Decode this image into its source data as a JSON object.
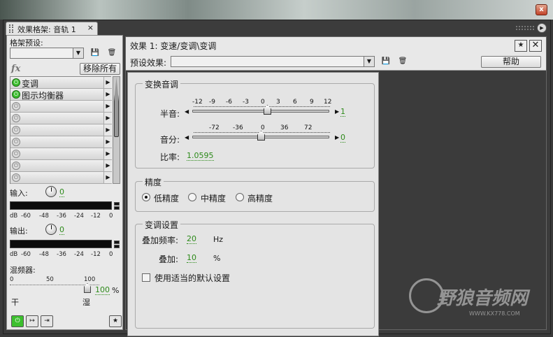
{
  "window": {
    "close_glyph": "x"
  },
  "panel_tab": {
    "title": "效果格架: 音轨 1",
    "close_glyph": "×",
    "menu_glyph": "▶"
  },
  "rack": {
    "preset_label": "格架预设:",
    "fx_label": "fx",
    "remove_all": "移除所有",
    "slots": [
      {
        "name": "变调",
        "on": true
      },
      {
        "name": "图示均衡器",
        "on": true
      },
      {
        "name": "",
        "on": false
      },
      {
        "name": "",
        "on": false
      },
      {
        "name": "",
        "on": false
      },
      {
        "name": "",
        "on": false
      },
      {
        "name": "",
        "on": false
      },
      {
        "name": "",
        "on": false
      },
      {
        "name": "",
        "on": false
      }
    ],
    "input_label": "输入:",
    "input_value": "0",
    "output_label": "输出:",
    "output_value": "0",
    "meter_scale": [
      "dB",
      "-60",
      "-48",
      "-36",
      "-24",
      "-12",
      "0"
    ],
    "mixer_label": "混频器:",
    "mixer_scale": [
      "0",
      "50",
      "100"
    ],
    "mixer_value": "100",
    "mixer_unit": "%",
    "mixer_level_percent": 100,
    "dry_label": "干",
    "wet_label": "湿"
  },
  "effect": {
    "title": "效果 1: 变速/变调\\变调",
    "preset_label": "预设效果:",
    "help": "帮助",
    "transpose_group": "变换音调",
    "semitones_label": "半音:",
    "semitone_ticks": [
      "-12",
      "-9",
      "-6",
      "-3",
      "0",
      "3",
      "6",
      "9",
      "12"
    ],
    "semitones_value": "1",
    "cents_label": "音分:",
    "cent_ticks": [
      "-72",
      "-36",
      "0",
      "36",
      "72"
    ],
    "cents_value": "0",
    "ratio_label": "比率:",
    "ratio_value": "1.0595",
    "precision_group": "精度",
    "precision_options": [
      "低精度",
      "中精度",
      "高精度"
    ],
    "precision_selected": "低精度",
    "pitch_group": "变调设置",
    "splice_label": "叠加频率:",
    "splice_value": "20",
    "splice_unit": "Hz",
    "overlap_label": "叠加:",
    "overlap_value": "10",
    "overlap_unit": "%",
    "default_cb": "使用适当的默认设置",
    "default_checked": false
  },
  "watermark": {
    "brand": "野狼音频网",
    "url": "WWW.KX778.COM"
  },
  "colors": {
    "accent_green": "#2d8a1a",
    "power_on": "#3cbf2e",
    "meter_bg": "#0c0c0c"
  }
}
